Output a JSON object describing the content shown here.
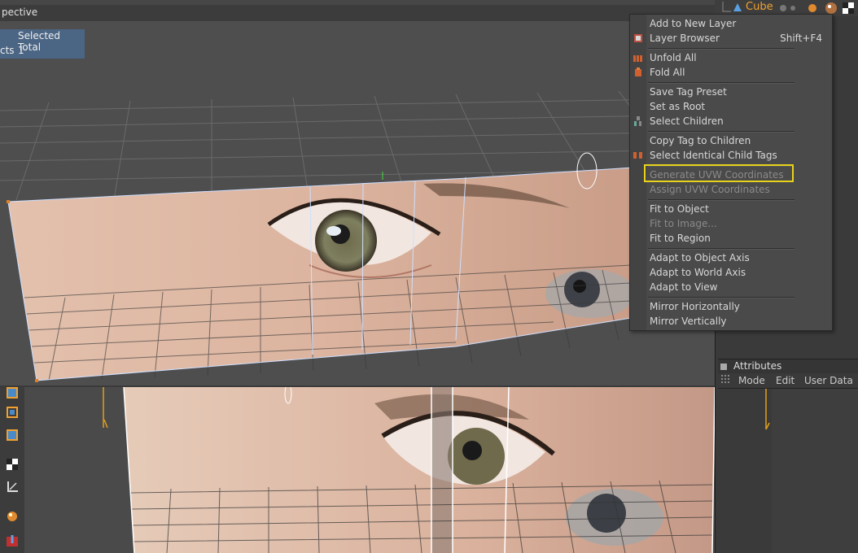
{
  "viewport": {
    "title": "pective",
    "selection_info": {
      "header": "Selected Total",
      "row_label": "cts",
      "row_value": "1"
    }
  },
  "object_manager": {
    "object_name": "Cube"
  },
  "attributes": {
    "title": "Attributes",
    "menu": [
      "Mode",
      "Edit",
      "User Data"
    ]
  },
  "context_menu": {
    "items": [
      {
        "label": "Add to New Layer",
        "shortcut": "",
        "enabled": true,
        "icon": ""
      },
      {
        "label": "Layer Browser",
        "shortcut": "Shift+F4",
        "enabled": true,
        "icon": "layer-browser-icon"
      },
      {
        "label": "Unfold All",
        "shortcut": "",
        "enabled": true,
        "icon": "unfold-all-icon"
      },
      {
        "label": "Fold All",
        "shortcut": "",
        "enabled": true,
        "icon": "fold-all-icon"
      },
      {
        "label": "Save Tag Preset",
        "shortcut": "",
        "enabled": true,
        "icon": ""
      },
      {
        "label": "Set as Root",
        "shortcut": "",
        "enabled": true,
        "icon": ""
      },
      {
        "label": "Select Children",
        "shortcut": "",
        "enabled": true,
        "icon": "select-children-icon"
      },
      {
        "label": "Copy Tag to Children",
        "shortcut": "",
        "enabled": true,
        "icon": ""
      },
      {
        "label": "Select Identical Child Tags",
        "shortcut": "",
        "enabled": true,
        "icon": "select-identical-child-tags-icon"
      },
      {
        "label": "Generate UVW Coordinates",
        "shortcut": "",
        "enabled": false,
        "icon": ""
      },
      {
        "label": "Assign UVW Coordinates",
        "shortcut": "",
        "enabled": false,
        "icon": ""
      },
      {
        "label": "Fit to Object",
        "shortcut": "",
        "enabled": true,
        "icon": ""
      },
      {
        "label": "Fit to Image...",
        "shortcut": "",
        "enabled": false,
        "icon": ""
      },
      {
        "label": "Fit to Region",
        "shortcut": "",
        "enabled": true,
        "icon": ""
      },
      {
        "label": "Adapt to Object Axis",
        "shortcut": "",
        "enabled": true,
        "icon": ""
      },
      {
        "label": "Adapt to World Axis",
        "shortcut": "",
        "enabled": true,
        "icon": ""
      },
      {
        "label": "Adapt to View",
        "shortcut": "",
        "enabled": true,
        "icon": ""
      },
      {
        "label": "Mirror Horizontally",
        "shortcut": "",
        "enabled": true,
        "icon": ""
      },
      {
        "label": "Mirror Vertically",
        "shortcut": "",
        "enabled": true,
        "icon": ""
      }
    ]
  },
  "colors": {
    "highlight_box": "#e8d21c",
    "selection_box": "#4b6584",
    "object_name": "#f0a030"
  }
}
